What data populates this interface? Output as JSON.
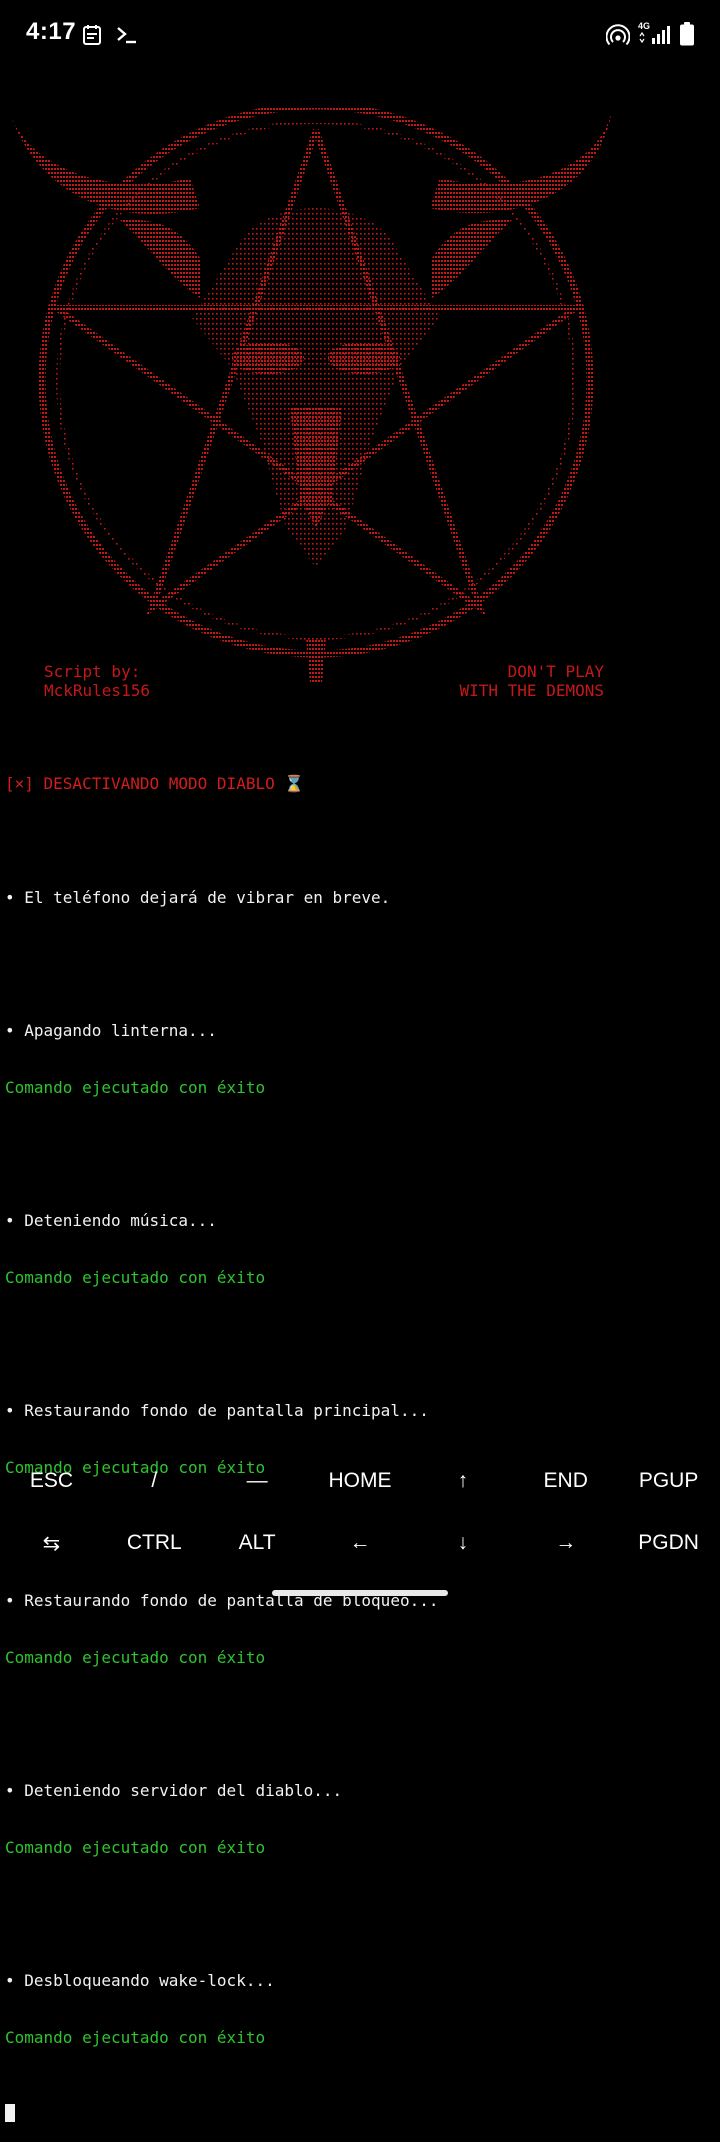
{
  "status_bar": {
    "time": "4:17",
    "network_label": "4G",
    "icons": [
      "calendar-icon",
      "terminal-icon",
      "hotspot-icon",
      "network-signal-icon",
      "battery-icon"
    ]
  },
  "banner": {
    "art_color": "#c41818",
    "credit_label": "Script by:",
    "credit_author": "MckRules156",
    "warning_line1": "DON'T PLAY",
    "warning_line2": "WITH THE DEMONS"
  },
  "terminal": {
    "header": "[×] DESACTIVANDO MODO DIABLO ⌛",
    "notice": "• El teléfono dejará de vibrar en breve.",
    "steps": [
      {
        "action": "• Apagando linterna...",
        "result": "Comando ejecutado con éxito"
      },
      {
        "action": "• Deteniendo música...",
        "result": "Comando ejecutado con éxito"
      },
      {
        "action": "• Restaurando fondo de pantalla principal...",
        "result": "Comando ejecutado con éxito"
      },
      {
        "action": "• Restaurando fondo de pantalla de bloqueo...",
        "result": "Comando ejecutado con éxito"
      },
      {
        "action": "• Deteniendo servidor del diablo...",
        "result": "Comando ejecutado con éxito"
      },
      {
        "action": "• Desbloqueando wake-lock...",
        "result": "Comando ejecutado con éxito"
      }
    ]
  },
  "extra_keys": {
    "row1": [
      "ESC",
      "/",
      "—",
      "HOME",
      "↑",
      "END",
      "PGUP"
    ],
    "row2": [
      "⇆",
      "CTRL",
      "ALT",
      "←",
      "↓",
      "→",
      "PGDN"
    ]
  },
  "colors": {
    "background": "#000000",
    "red": "#d31c1c",
    "green": "#2fc42f",
    "text": "#f2f2f2"
  }
}
